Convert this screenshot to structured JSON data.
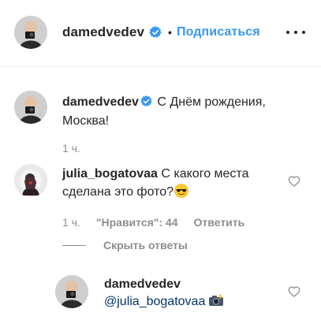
{
  "header": {
    "username": "damedvedev",
    "separator": "•",
    "follow_label": "Подписаться"
  },
  "caption": {
    "username": "damedvedev",
    "text": "С Днём рождения, Москва!",
    "time": "1 ч."
  },
  "comment": {
    "username": "julia_bogatovaa",
    "text": "С какого места сделана это фото?",
    "emoji": "smiling-face-with-sunglasses",
    "time": "1 ч.",
    "likes": "\"Нравится\": 44",
    "reply_label": "Ответить",
    "hide_replies_label": "Скрыть ответы"
  },
  "reply": {
    "username": "damedvedev",
    "mention": "@julia_bogatovaa",
    "emoji": "camera-with-flash"
  },
  "colors": {
    "link_blue": "#3897f0",
    "verified_blue": "#3897f0",
    "muted_gray": "#8e8e8e",
    "text_dark": "#262626",
    "mention_blue": "#003569"
  }
}
